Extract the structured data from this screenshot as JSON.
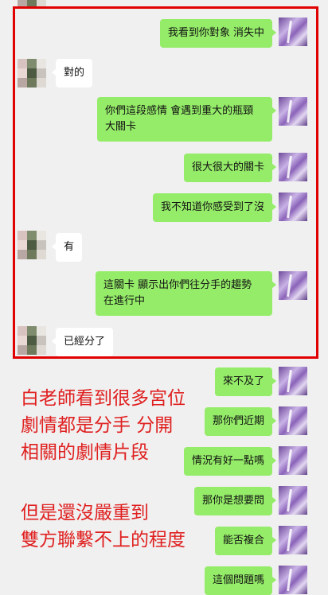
{
  "messages": [
    {
      "id": "m1",
      "side": "self",
      "text": "我看到你對象 消失中"
    },
    {
      "id": "m2",
      "side": "other",
      "text": "對的"
    },
    {
      "id": "m3",
      "side": "self",
      "lines": [
        "你們這段感情 會遇到重大的瓶頸",
        "大關卡"
      ]
    },
    {
      "id": "m4",
      "side": "self",
      "text": "很大很大的關卡"
    },
    {
      "id": "m5",
      "side": "self",
      "text": "我不知道你感受到了沒"
    },
    {
      "id": "m6",
      "side": "other",
      "text": "有"
    },
    {
      "id": "m7",
      "side": "self",
      "lines": [
        "這關卡 顯示出你們往分手的趨勢",
        "在進行中"
      ]
    },
    {
      "id": "m8",
      "side": "other",
      "text": "已經分了"
    },
    {
      "id": "m9",
      "side": "self",
      "text": "來不及了"
    },
    {
      "id": "m10",
      "side": "self",
      "text": "那你們近期"
    },
    {
      "id": "m11",
      "side": "self",
      "text": "情況有好一點嗎"
    },
    {
      "id": "m12",
      "side": "self",
      "text": "那你是想要問"
    },
    {
      "id": "m13",
      "side": "self",
      "text": "能否複合"
    },
    {
      "id": "m14",
      "side": "self",
      "text": "這個問題嗎"
    }
  ],
  "annotation": {
    "block1": [
      "白老師看到很多宮位",
      "劇情都是分手 分開",
      "相關的劇情片段"
    ],
    "block2": [
      "但是還沒嚴重到",
      "雙方聯繫不上的程度"
    ]
  },
  "colors": {
    "self_bubble": "#95ec69",
    "other_bubble": "#ffffff",
    "highlight": "#e00000",
    "annotation": "#e02020"
  }
}
